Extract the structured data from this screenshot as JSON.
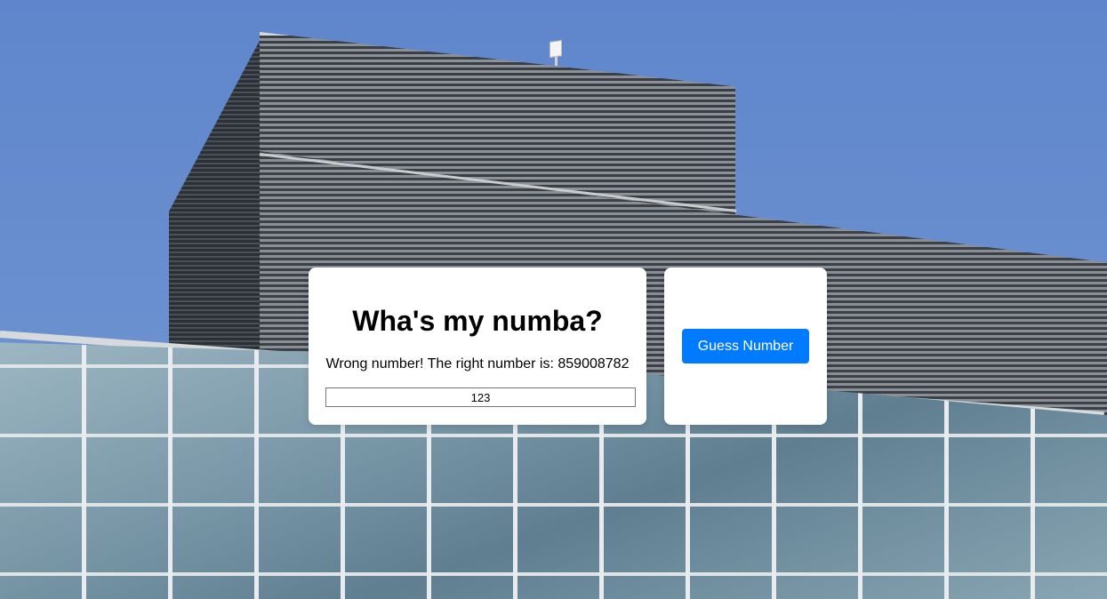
{
  "game": {
    "title": "Wha's my numba?",
    "message": "Wrong number! The right number is: 859008782",
    "input_value": "123"
  },
  "actions": {
    "guess_button_label": "Guess Number",
    "button_color": "#007bff"
  },
  "background": {
    "subject": "office building rooftop against blue sky",
    "sky_color": "#6a8fcf"
  }
}
